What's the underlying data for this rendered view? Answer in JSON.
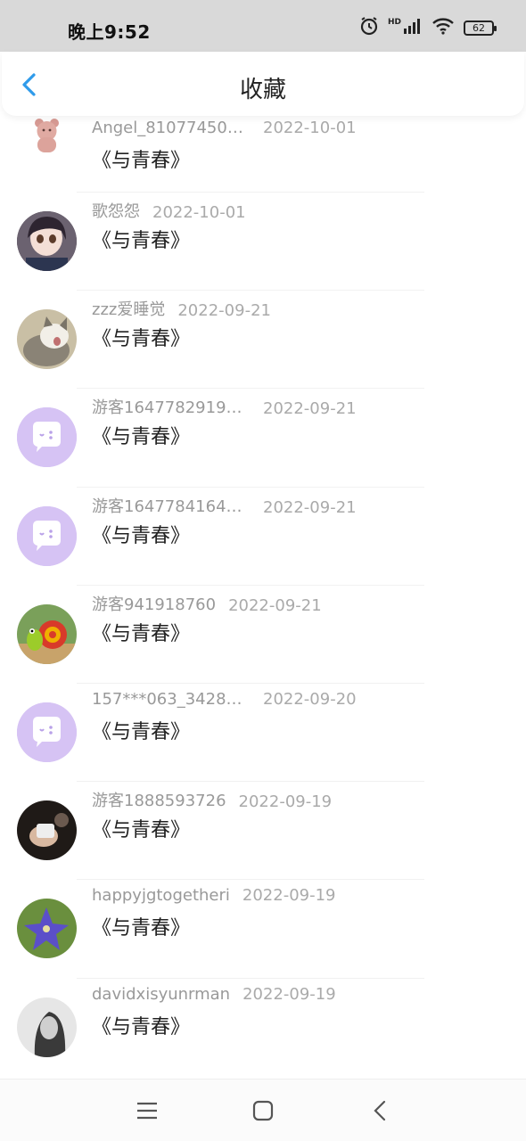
{
  "status_bar": {
    "time": "晚上9:52",
    "hd": "HD",
    "battery": "62"
  },
  "header": {
    "title": "收藏"
  },
  "items": [
    {
      "user": "Angel_810774506...",
      "date": "2022-10-01",
      "book": "《与青春》",
      "avatar": "teddy-bear"
    },
    {
      "user": "歌怨怨",
      "date": "2022-10-01",
      "book": "《与青春》",
      "avatar": "anime-girl"
    },
    {
      "user": "zzz爱睡觉",
      "date": "2022-09-21",
      "book": "《与青春》",
      "avatar": "cat"
    },
    {
      "user": "游客16477829191...",
      "date": "2022-09-21",
      "book": "《与青春》",
      "avatar": "default-chat"
    },
    {
      "user": "游客16477841645...",
      "date": "2022-09-21",
      "book": "《与青春》",
      "avatar": "default-chat"
    },
    {
      "user": "游客941918760",
      "date": "2022-09-21",
      "book": "《与青春》",
      "avatar": "snail"
    },
    {
      "user": "157***063_34285...",
      "date": "2022-09-20",
      "book": "《与青春》",
      "avatar": "default-chat"
    },
    {
      "user": "游客1888593726",
      "date": "2022-09-19",
      "book": "《与青春》",
      "avatar": "hand-photo"
    },
    {
      "user": "happyjgtogetheri",
      "date": "2022-09-19",
      "book": "《与青春》",
      "avatar": "flower"
    },
    {
      "user": "davidxisyunrman",
      "date": "2022-09-19",
      "book": "《与青春》",
      "avatar": "portrait"
    }
  ],
  "colors": {
    "accent": "#2f9bea",
    "default_avatar": "#d6c3f4"
  }
}
